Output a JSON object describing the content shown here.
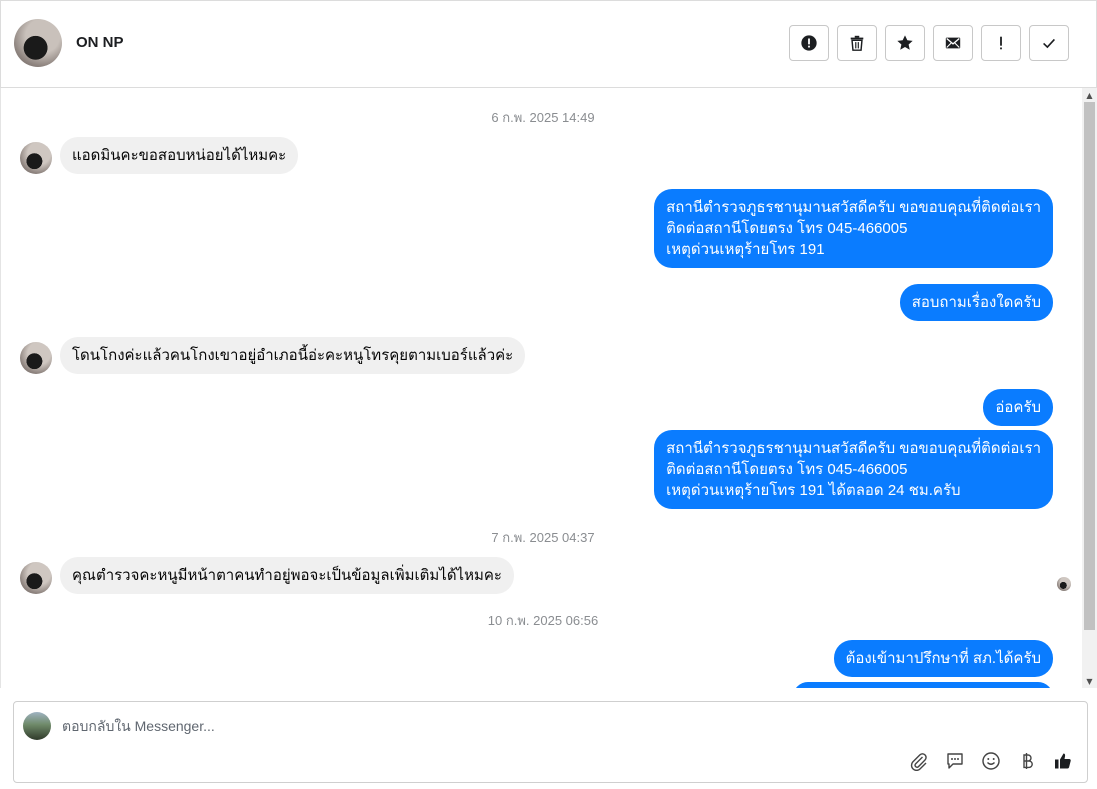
{
  "header": {
    "contact_name": "ON NP",
    "toolbar": [
      {
        "name": "spam-button",
        "icon": "alert-circle-icon"
      },
      {
        "name": "delete-button",
        "icon": "trash-icon"
      },
      {
        "name": "star-button",
        "icon": "star-icon"
      },
      {
        "name": "mark-unread-button",
        "icon": "envelope-icon"
      },
      {
        "name": "important-button",
        "icon": "exclamation-icon"
      },
      {
        "name": "done-button",
        "icon": "check-icon"
      }
    ]
  },
  "conversation": {
    "timestamps": [
      "6 ก.พ. 2025 14:49",
      "7 ก.พ. 2025 04:37",
      "10 ก.พ. 2025 06:56"
    ],
    "messages": [
      {
        "from": "in",
        "text": "แอดมินคะขอสอบหน่อยได้ไหมคะ"
      },
      {
        "from": "out",
        "text": "สถานีตำรวจภูธรชานุมานสวัสดีครับ ขอขอบคุณที่ติดต่อเรา\nติดต่อสถานีโดยตรง โทร 045-466005\nเหตุด่วนเหตุร้ายโทร 191"
      },
      {
        "from": "out",
        "text": "สอบถามเรื่องใดครับ"
      },
      {
        "from": "in",
        "text": "โดนโกงค่ะแล้วคนโกงเขาอยู่อำเภอนี้อ่ะคะหนูโทรคุยตามเบอร์แล้วค่ะ"
      },
      {
        "from": "out",
        "text": "อ่อครับ"
      },
      {
        "from": "out",
        "text": "สถานีตำรวจภูธรชานุมานสวัสดีครับ ขอขอบคุณที่ติดต่อเรา\nติดต่อสถานีโดยตรง โทร 045-466005\nเหตุด่วนเหตุร้ายโทร 191 ได้ตลอด 24 ชม.ครับ"
      },
      {
        "from": "in",
        "text": "คุณตำรวจคะหนูมีหน้าตาคนทำอยู่พอจะเป็นข้อมูลเพิ่มเติมได้ไหมคะ"
      },
      {
        "from": "out",
        "text": "ต้องเข้ามาปรึกษาที่ สภ.ได้ครับ"
      }
    ]
  },
  "composer": {
    "placeholder": "ตอบกลับใน Messenger...",
    "tools": [
      "paperclip-icon",
      "chat-bubble-icon",
      "emoji-icon",
      "baht-icon",
      "thumbs-up-icon"
    ]
  },
  "colors": {
    "outgoing_bubble": "#0a7cff",
    "incoming_bubble": "#f0f0f0",
    "timestamp_text": "#8a8d91"
  }
}
